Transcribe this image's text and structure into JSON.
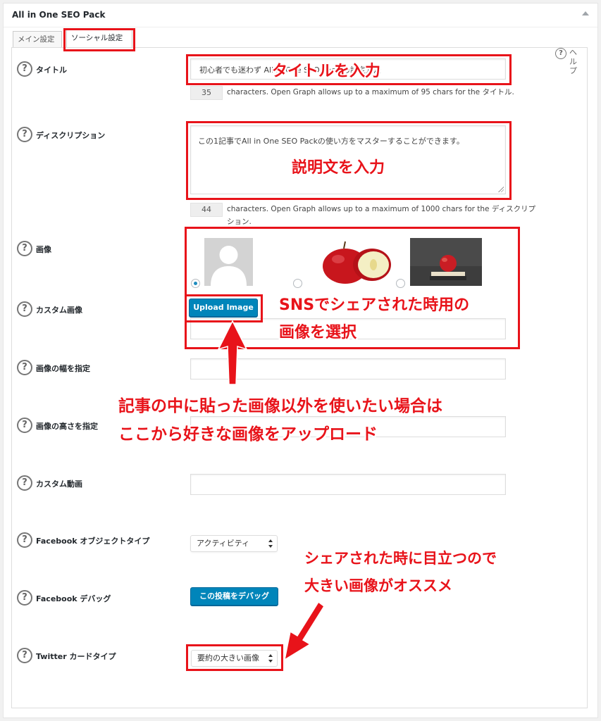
{
  "panel": {
    "title": "All in One SEO Pack"
  },
  "tabs": [
    {
      "label": "メイン設定",
      "active": false
    },
    {
      "label": "ソーシャル設定",
      "active": true
    }
  ],
  "help": {
    "label": "ヘルプ"
  },
  "fields": {
    "title": {
      "label": "タイトル",
      "value": "初心者でも迷わず All in One SEO Pack の設定方法",
      "count": "35",
      "count_note": "characters. Open Graph allows up to a maximum of 95 chars for the タイトル."
    },
    "description": {
      "label": "ディスクリプション",
      "value": "この1記事でAll in One SEO Packの使い方をマスターすることができます。",
      "count": "44",
      "count_note": "characters. Open Graph allows up to a maximum of 1000 chars for the ディスクリプション."
    },
    "image": {
      "label": "画像",
      "options": [
        "default-avatar",
        "apple-halves",
        "apple-on-books"
      ],
      "selected": 0
    },
    "custom_image": {
      "label": "カスタム画像",
      "upload_label": "Upload Image"
    },
    "image_width": {
      "label": "画像の幅を指定"
    },
    "image_height": {
      "label": "画像の高さを指定"
    },
    "custom_video": {
      "label": "カスタム動画"
    },
    "fb_object_type": {
      "label": "Facebook オブジェクトタイプ",
      "value": "アクティビティ"
    },
    "fb_debug": {
      "label": "Facebook デバッグ",
      "button_label": "この投稿をデバッグ"
    },
    "twitter_card": {
      "label": "Twitter カードタイプ",
      "value": "要約の大きい画像"
    }
  },
  "annotations": {
    "title_hint": "タイトルを入力",
    "desc_hint": "説明文を入力",
    "image_hint_1": "SNSでシェアされた時用の",
    "image_hint_2": "画像を選択",
    "upload_hint_1": "記事の中に貼った画像以外を使いたい場合は",
    "upload_hint_2": "ここから好きな画像をアップロード",
    "twitter_hint_1": "シェアされた時に目立つので",
    "twitter_hint_2": "大きい画像がオススメ"
  },
  "colors": {
    "accent_red": "#e8131a",
    "wp_blue": "#0085ba"
  }
}
